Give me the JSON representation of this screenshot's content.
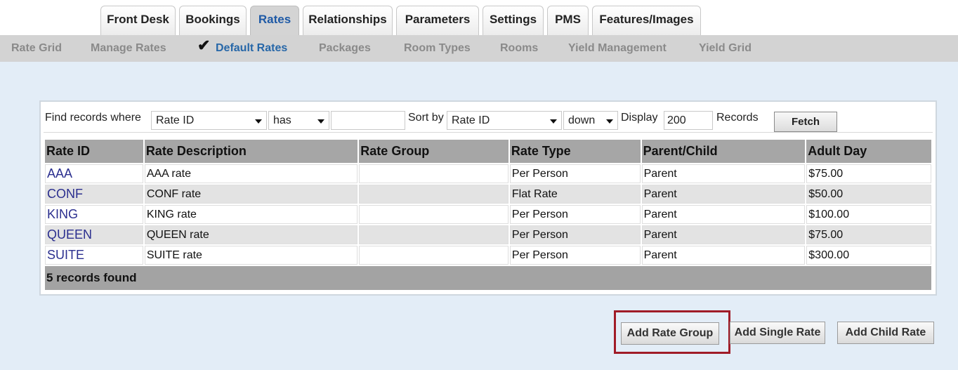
{
  "tabs": [
    "Front Desk",
    "Bookings",
    "Rates",
    "Relationships",
    "Parameters",
    "Settings",
    "PMS",
    "Features/Images"
  ],
  "active_tab": "Rates",
  "subnav": [
    "Rate Grid",
    "Manage Rates",
    "Default Rates",
    "Packages",
    "Room Types",
    "Rooms",
    "Yield Management",
    "Yield Grid"
  ],
  "active_subnav": "Default Rates",
  "check_mark": "✔",
  "find": {
    "label": "Find records where",
    "field_value": "Rate ID",
    "operator_value": "has",
    "search_value": "",
    "sort_label": "Sort by",
    "sort_value": "Rate ID",
    "direction_value": "down",
    "display_label": "Display",
    "display_value": "200",
    "records_label": "Records",
    "fetch_label": "Fetch"
  },
  "table": {
    "headers": [
      "Rate ID",
      "Rate Description",
      "Rate Group",
      "Rate Type",
      "Parent/Child",
      "Adult Day"
    ],
    "rows": [
      {
        "id": "AAA",
        "description": "AAA rate",
        "group": "",
        "type": "Per Person",
        "parent_child": "Parent",
        "adult_day": "$75.00"
      },
      {
        "id": "CONF",
        "description": "CONF rate",
        "group": "",
        "type": "Flat Rate",
        "parent_child": "Parent",
        "adult_day": "$50.00"
      },
      {
        "id": "KING",
        "description": "KING rate",
        "group": "",
        "type": "Per Person",
        "parent_child": "Parent",
        "adult_day": "$100.00"
      },
      {
        "id": "QUEEN",
        "description": "QUEEN rate",
        "group": "",
        "type": "Per Person",
        "parent_child": "Parent",
        "adult_day": "$75.00"
      },
      {
        "id": "SUITE",
        "description": "SUITE rate",
        "group": "",
        "type": "Per Person",
        "parent_child": "Parent",
        "adult_day": "$300.00"
      }
    ],
    "footer": "5 records found"
  },
  "buttons": {
    "add_rate_group": "Add Rate Group",
    "add_single_rate": "Add Single Rate",
    "add_child_rate": "Add Child Rate"
  },
  "colors": {
    "active_tab_text": "#1f5aa6",
    "subnav_bg": "#d3d3d3",
    "content_bg": "#e3edf7",
    "highlight_border": "#a01c28",
    "link_text": "#2b2f8f"
  }
}
